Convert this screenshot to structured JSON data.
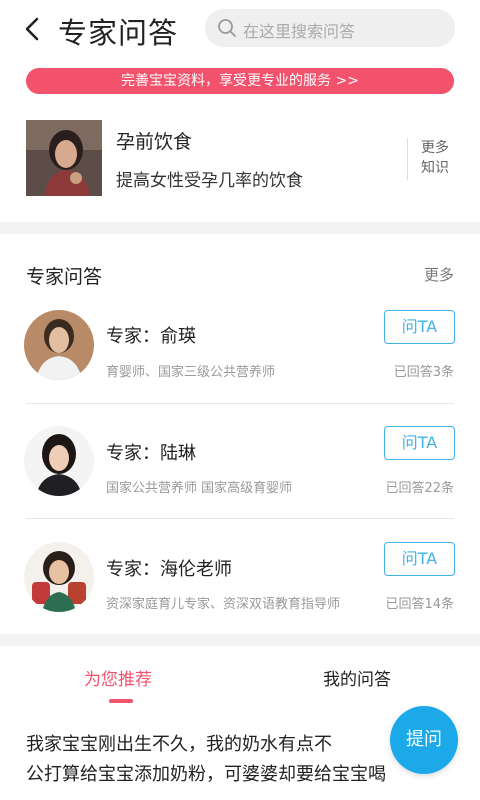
{
  "header": {
    "title": "专家问答",
    "search_placeholder": "在这里搜索问答"
  },
  "banner": {
    "text": "完善宝宝资料，享受更专业的服务 >>"
  },
  "knowledge": {
    "title": "孕前饮食",
    "subtitle": "提高女性受孕几率的饮食",
    "more_label_line1": "更多",
    "more_label_line2": "知识"
  },
  "experts_section": {
    "title": "专家问答",
    "more_label": "更多",
    "experts": [
      {
        "name": "专家：俞瑛",
        "desc": "育婴师、国家三级公共营养师",
        "button": "问TA",
        "answered": "已回答3条"
      },
      {
        "name": "专家：陆琳",
        "desc": "国家公共营养师 国家高级育婴师",
        "button": "问TA",
        "answered": "已回答22条"
      },
      {
        "name": "专家：海伦老师",
        "desc": "资深家庭育儿专家、资深双语教育指导师",
        "button": "问TA",
        "answered": "已回答14条"
      }
    ]
  },
  "tabs": {
    "recommended": "为您推荐",
    "mine": "我的问答"
  },
  "post": {
    "line1": "我家宝宝刚出生不久，我的奶水有点不",
    "line2": "公打算给宝宝添加奶粉，可婆婆却要给宝宝喝"
  },
  "fab": {
    "label": "提问"
  },
  "colors": {
    "accent_pink": "#f2526b",
    "accent_blue": "#3fb3e6",
    "fab_blue": "#1ba9ea"
  }
}
